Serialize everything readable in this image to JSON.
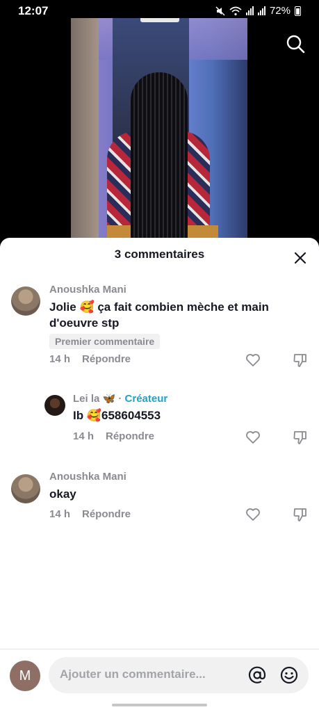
{
  "status_bar": {
    "time": "12:07",
    "battery": "72%"
  },
  "sheet": {
    "title": "3 commentaires"
  },
  "comments": [
    {
      "username": "Anoushka Mani",
      "text_line1": "Jolie 🥰 ça fait combien mèche et main",
      "text_line2": "d'oeuvre stp",
      "badge": "Premier commentaire",
      "time": "14 h",
      "reply_label": "Répondre"
    },
    {
      "username": "Lei la 🦋",
      "separator": "·",
      "creator_label": "Créateur",
      "text": "Ib 🥰658604553",
      "time": "14 h",
      "reply_label": "Répondre"
    },
    {
      "username": "Anoushka Mani",
      "text": "okay",
      "time": "14 h",
      "reply_label": "Répondre"
    }
  ],
  "composer": {
    "avatar_letter": "M",
    "placeholder": "Ajouter un commentaire..."
  },
  "icons": {
    "search": "search-icon",
    "close": "close-icon",
    "like": "heart-icon",
    "dislike": "thumbs-down-icon",
    "mention": "at-icon",
    "emoji": "emoji-icon"
  },
  "colors": {
    "creator_accent": "#20a1c6",
    "muted_text": "#8a8b91",
    "primary_text": "#161823"
  }
}
